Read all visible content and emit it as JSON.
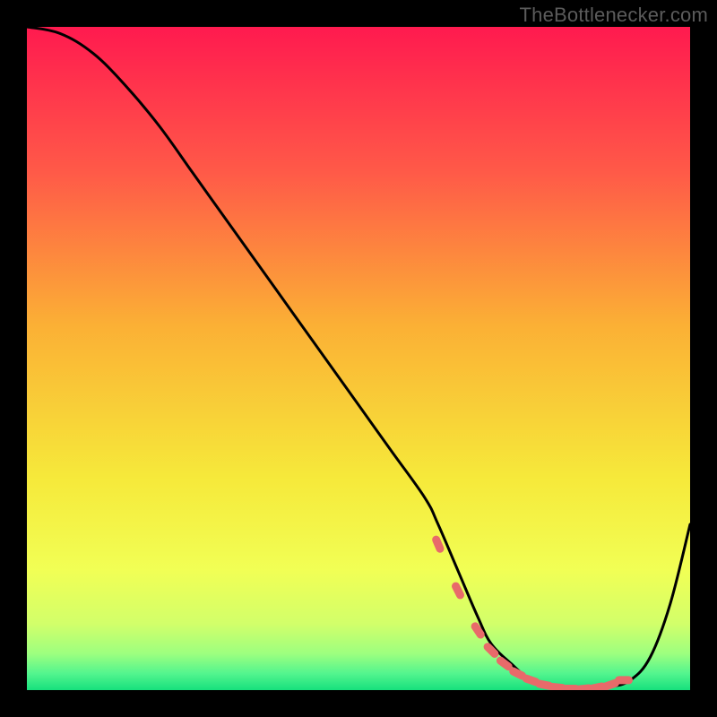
{
  "attribution": "TheBottlenecker.com",
  "chart_data": {
    "type": "line",
    "title": "",
    "xlabel": "",
    "ylabel": "",
    "xlim": [
      0,
      100
    ],
    "ylim": [
      0,
      100
    ],
    "gradient_stops": [
      {
        "offset": 0.0,
        "color": "#ff1a4f"
      },
      {
        "offset": 0.22,
        "color": "#ff5a48"
      },
      {
        "offset": 0.45,
        "color": "#fbb035"
      },
      {
        "offset": 0.68,
        "color": "#f6e93a"
      },
      {
        "offset": 0.82,
        "color": "#f1ff55"
      },
      {
        "offset": 0.9,
        "color": "#d2ff6a"
      },
      {
        "offset": 0.945,
        "color": "#9dff7f"
      },
      {
        "offset": 0.975,
        "color": "#53f58e"
      },
      {
        "offset": 1.0,
        "color": "#16e07d"
      }
    ],
    "series": [
      {
        "name": "bottleneck-curve",
        "x": [
          0,
          5,
          10,
          15,
          20,
          25,
          30,
          35,
          40,
          45,
          50,
          55,
          60,
          62,
          65,
          68,
          70,
          73,
          76,
          79,
          82,
          85,
          88,
          91,
          94,
          97,
          100
        ],
        "y": [
          100,
          99,
          96,
          91,
          85,
          78,
          71,
          64,
          57,
          50,
          43,
          36,
          29,
          25,
          18,
          11,
          7,
          4,
          1.5,
          0.5,
          0.2,
          0.2,
          0.5,
          1.5,
          5,
          13,
          25
        ]
      }
    ],
    "markers": {
      "name": "highlight-segment",
      "color": "#e86a6a",
      "x": [
        62,
        65,
        68,
        70,
        72,
        74,
        76,
        78,
        80,
        82,
        84,
        86,
        88,
        90
      ],
      "y": [
        22,
        15,
        9,
        6,
        4,
        2.5,
        1.5,
        0.8,
        0.4,
        0.2,
        0.2,
        0.4,
        0.8,
        1.5
      ]
    }
  }
}
